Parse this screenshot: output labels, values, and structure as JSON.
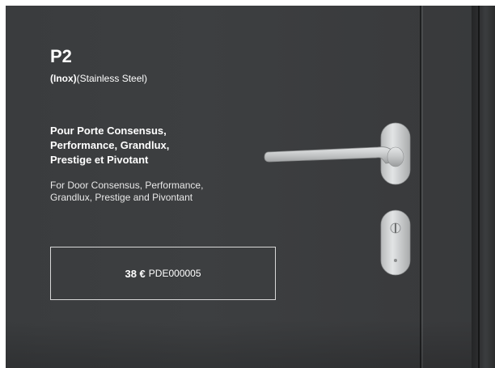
{
  "product": {
    "title": "P2",
    "subtitle_bold": "(Inox)",
    "subtitle_rest": "(Stainless Steel)",
    "desc_fr_lines": [
      "Pour Porte Consensus,",
      "Performance, Grandlux,",
      "Prestige et  Pivotant"
    ],
    "desc_en_lines": [
      "For Door Consensus, Performance,",
      "Grandlux, Prestige and Pivontant"
    ],
    "price": "38 €",
    "reference": "PDE000005"
  },
  "colors": {
    "door": "#3c3e40",
    "text": "#ffffff",
    "box_border": "#d8d8d8",
    "steel": "#c8cacb"
  },
  "icons": {
    "handle": "door-handle-icon",
    "lock": "key-cylinder-icon"
  }
}
